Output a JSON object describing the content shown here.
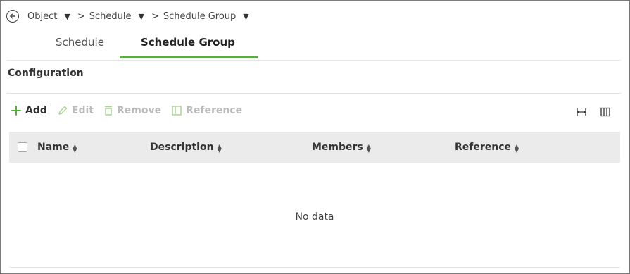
{
  "breadcrumb": {
    "items": [
      {
        "label": "Object"
      },
      {
        "label": "Schedule"
      },
      {
        "label": "Schedule Group"
      }
    ],
    "separator": ">"
  },
  "tabs": [
    {
      "label": "Schedule",
      "active": false
    },
    {
      "label": "Schedule Group",
      "active": true
    }
  ],
  "section": {
    "title": "Configuration"
  },
  "toolbar": {
    "add": "Add",
    "edit": "Edit",
    "remove": "Remove",
    "reference": "Reference",
    "icons": [
      "plus-icon",
      "pencil-icon",
      "trash-icon",
      "reference-icon",
      "column-width-icon",
      "columns-icon"
    ]
  },
  "table": {
    "columns": [
      {
        "label": "Name"
      },
      {
        "label": "Description"
      },
      {
        "label": "Members"
      },
      {
        "label": "Reference"
      }
    ],
    "empty_text": "No data"
  },
  "colors": {
    "accent": "#55b03a",
    "header_bg": "#ebebeb",
    "disabled": "#bcbcbc"
  }
}
